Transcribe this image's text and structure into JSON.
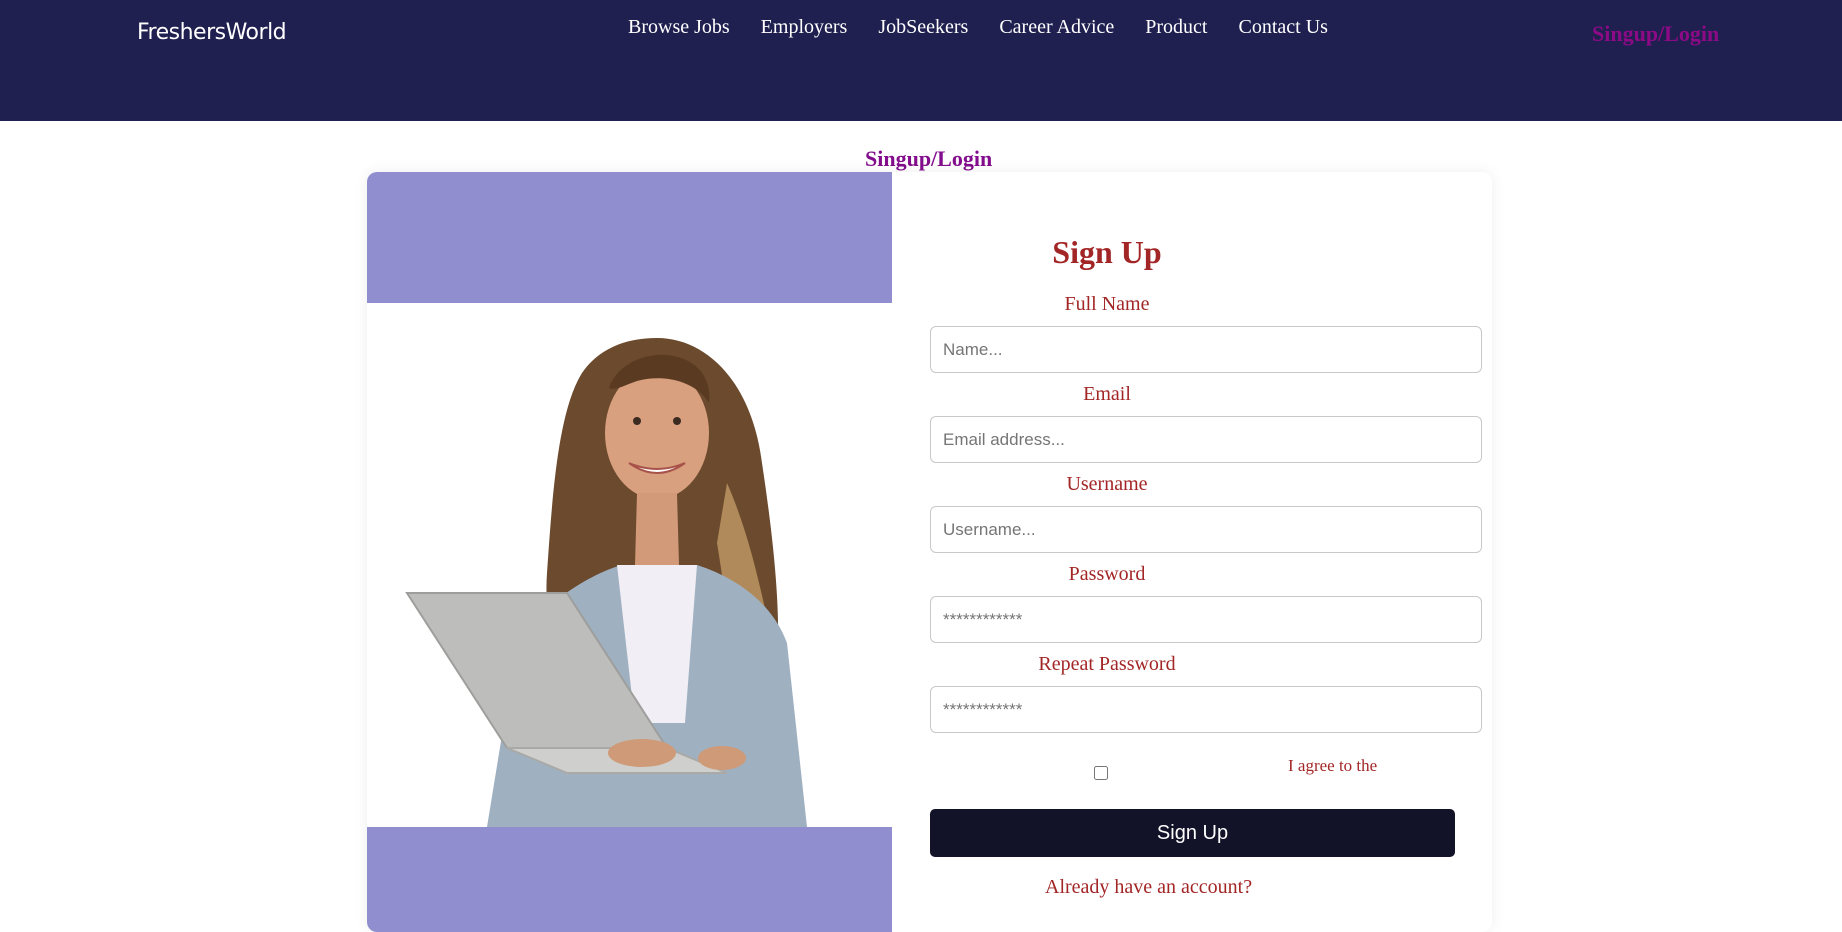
{
  "header": {
    "brand": "FreshersWorld",
    "nav": [
      "Browse Jobs",
      "Employers",
      "JobSeekers",
      "Career Advice",
      "Product",
      "Contact Us"
    ],
    "login_link": "Singup/Login",
    "background_color": "#1f1f50",
    "login_color": "#8d0a87"
  },
  "page": {
    "heading": "Singup/Login"
  },
  "hero": {
    "band_color": "#918ecf",
    "image_description": "woman-holding-laptop-photo"
  },
  "form": {
    "title": "Sign Up",
    "accent_color": "#a32626",
    "fields": [
      {
        "label": "Full Name",
        "placeholder": "Name..."
      },
      {
        "label": "Email",
        "placeholder": "Email address..."
      },
      {
        "label": "Username",
        "placeholder": "Username..."
      },
      {
        "label": "Password",
        "placeholder": "************"
      },
      {
        "label": "Repeat Password",
        "placeholder": "************"
      }
    ],
    "agree_text": "I agree to the",
    "submit_label": "Sign Up",
    "submit_color": "#121228",
    "already_text": "Already have an account?"
  }
}
